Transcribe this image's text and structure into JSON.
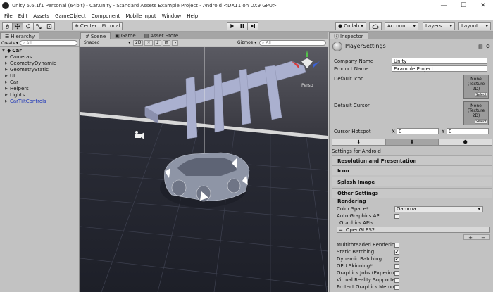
{
  "window": {
    "title": "Unity 5.6.1f1 Personal (64bit) - Car.unity - Standard Assets Example Project - Android <DX11 on DX9 GPU>",
    "minimize_glyph": "—",
    "maximize_glyph": "☐",
    "close_glyph": "✕"
  },
  "menu": [
    "File",
    "Edit",
    "Assets",
    "GameObject",
    "Component",
    "Mobile Input",
    "Window",
    "Help"
  ],
  "toolbar": {
    "pivot_label": "Center",
    "space_label": "Local",
    "collab_label": "Collab ▾",
    "account_label": "Account",
    "layers_label": "Layers",
    "layout_label": "Layout",
    "dropdown_glyph": "▾"
  },
  "hierarchy": {
    "tab_label": "Hierarchy",
    "create_label": "Create",
    "search_placeholder": "All",
    "root": "Car",
    "items": [
      {
        "label": "Cameras",
        "blue": false
      },
      {
        "label": "GeometryDynamic",
        "blue": false
      },
      {
        "label": "GeometryStatic",
        "blue": false
      },
      {
        "label": "UI",
        "blue": false
      },
      {
        "label": "Car",
        "blue": false
      },
      {
        "label": "Helpers",
        "blue": false
      },
      {
        "label": "Lights",
        "blue": false
      },
      {
        "label": "CarTiltControls",
        "blue": true
      }
    ]
  },
  "scene": {
    "tabs": [
      "Scene",
      "Game",
      "Asset Store"
    ],
    "shading_mode": "Shaded",
    "mode_2d": "2D",
    "gizmos_label": "Gizmos",
    "search_placeholder": "All",
    "gizmo_label": "Persp"
  },
  "inspector": {
    "tab_label": "Inspector",
    "object_name": "PlayerSettings",
    "company_name_label": "Company Name",
    "company_name_value": "Unity",
    "product_name_label": "Product Name",
    "product_name_value": "Example Project",
    "default_icon_label": "Default Icon",
    "default_cursor_label": "Default Cursor",
    "texture_none": "None (Texture 2D)",
    "select_label": "Select",
    "cursor_hotspot_label": "Cursor Hotspot",
    "hotspot_x_label": "X",
    "hotspot_x": "0",
    "hotspot_y_label": "Y",
    "hotspot_y": "0",
    "settings_for": "Settings for Android",
    "sections": [
      "Resolution and Presentation",
      "Icon",
      "Splash Image",
      "Other Settings"
    ],
    "rendering_label": "Rendering",
    "color_space_label": "Color Space*",
    "color_space_value": "Gamma",
    "auto_graphics_label": "Auto Graphics API",
    "graphics_apis_label": "Graphics APIs",
    "graphics_api_item": "OpenGLES2",
    "list_add": "+",
    "list_remove": "−",
    "options": [
      {
        "label": "Multithreaded Rendering*",
        "checked": false
      },
      {
        "label": "Static Batching",
        "checked": true
      },
      {
        "label": "Dynamic Batching",
        "checked": true
      },
      {
        "label": "GPU Skinning*",
        "checked": false
      },
      {
        "label": "Graphics Jobs (Experimen",
        "checked": false
      },
      {
        "label": "Virtual Reality Supported",
        "checked": false
      },
      {
        "label": "Protect Graphics Memory",
        "checked": false
      }
    ]
  },
  "colors": {
    "sky_top": "#5a5a62",
    "sky_bottom": "#34343c",
    "ground": "#232530",
    "grid": "#3e4150",
    "bridge": "#aab0cf",
    "car": "#8e95a6"
  }
}
